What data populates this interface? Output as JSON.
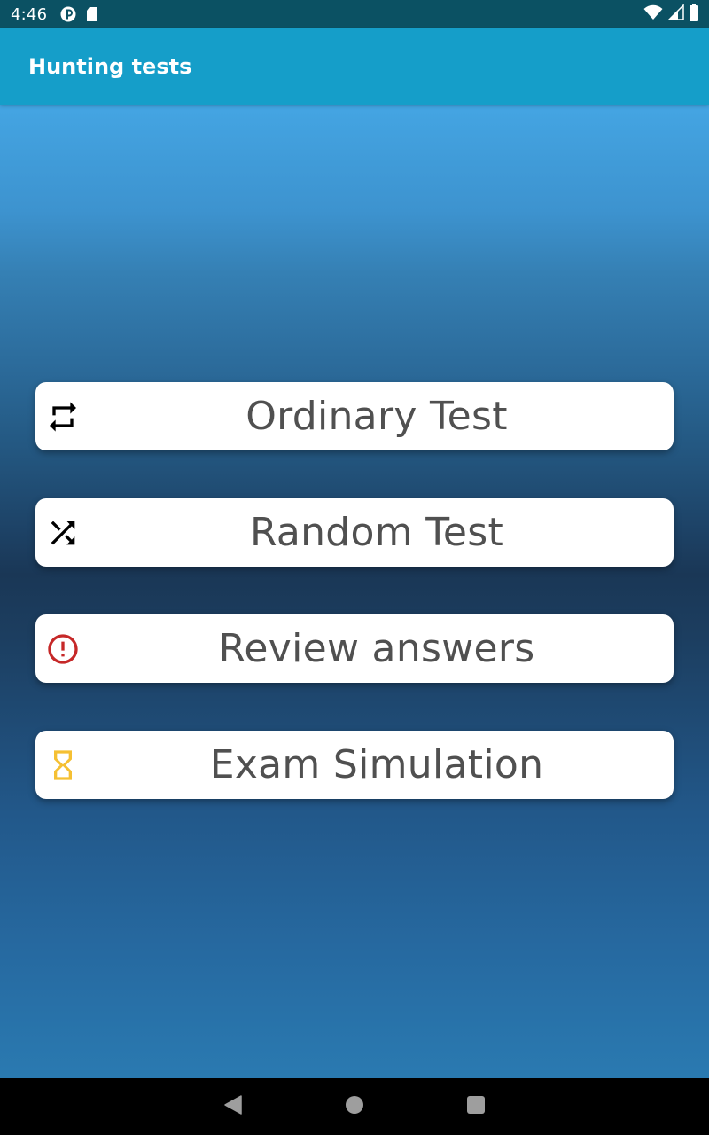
{
  "status_bar": {
    "time": "4:46",
    "left_icons": [
      "data-saver-icon",
      "sd-card-icon"
    ],
    "right_icons": [
      "wifi-icon",
      "cellular-signal-icon",
      "battery-icon"
    ]
  },
  "app_bar": {
    "title": "Hunting tests"
  },
  "menu": {
    "buttons": [
      {
        "label": "Ordinary Test",
        "icon": "repeat-icon",
        "icon_color": "#000000"
      },
      {
        "label": "Random Test",
        "icon": "shuffle-icon",
        "icon_color": "#000000"
      },
      {
        "label": "Review answers",
        "icon": "error-outline-icon",
        "icon_color": "#c62828"
      },
      {
        "label": "Exam Simulation",
        "icon": "hourglass-icon",
        "icon_color": "#f5c033"
      }
    ]
  },
  "nav_bar": {
    "back": "back-icon",
    "home": "home-icon",
    "recents": "recents-icon"
  },
  "colors": {
    "status_bar": "#0b5163",
    "app_bar": "#159ec9",
    "button_text": "#505050",
    "nav_icons": "#9e9e9e"
  }
}
